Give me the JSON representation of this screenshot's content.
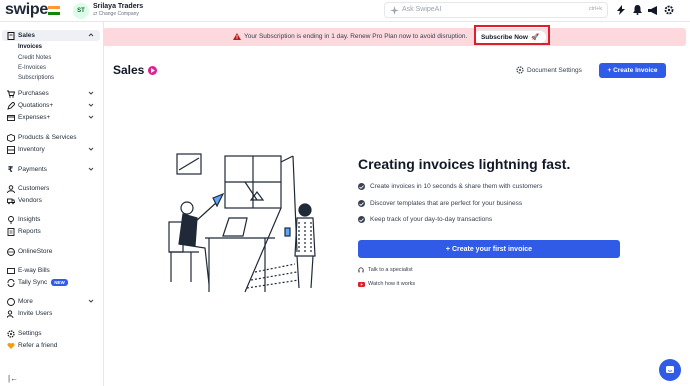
{
  "brand": {
    "logo": "swipe",
    "accent": "#2f5be7"
  },
  "company": {
    "initials": "ST",
    "name": "Srilaya Traders",
    "change_label": "Change Company"
  },
  "search": {
    "placeholder": "Ask SwipeAI",
    "shortcut": "ctrl+k"
  },
  "top_icons": [
    "bolt-icon",
    "bell-icon",
    "megaphone-icon",
    "settings-icon"
  ],
  "sidebar": {
    "sales": {
      "label": "Sales",
      "icon": "sales-icon"
    },
    "sales_subitems": [
      "Invoices",
      "Credit Notes",
      "E-Invoices",
      "Subscriptions"
    ],
    "items": [
      {
        "label": "Purchases",
        "icon": "cart-icon"
      },
      {
        "label": "Quotations+",
        "icon": "quote-icon"
      },
      {
        "label": "Expenses+",
        "icon": "expense-icon"
      },
      {
        "label": "Products & Services",
        "icon": "box-icon"
      },
      {
        "label": "Inventory",
        "icon": "inventory-icon"
      },
      {
        "label": "Payments",
        "icon": "rupee-icon"
      },
      {
        "label": "Customers",
        "icon": "user-icon"
      },
      {
        "label": "Vendors",
        "icon": "truck-icon"
      },
      {
        "label": "Insights",
        "icon": "bulb-icon"
      },
      {
        "label": "Reports",
        "icon": "report-icon"
      },
      {
        "label": "OnlineStore",
        "icon": "globe-icon"
      },
      {
        "label": "E-way Bills",
        "icon": "bill-icon"
      },
      {
        "label": "Tally Sync",
        "icon": "sync-icon",
        "badge": "NEW"
      },
      {
        "label": "More",
        "icon": "more-icon"
      },
      {
        "label": "Invite Users",
        "icon": "invite-icon"
      },
      {
        "label": "Settings",
        "icon": "settings-icon"
      },
      {
        "label": "Refer a friend",
        "icon": "heart-icon"
      }
    ]
  },
  "banner": {
    "message": "Your Subscription is ending in 1 day. Renew Pro Plan now to avoid disruption.",
    "button": "Subscribe Now"
  },
  "main": {
    "title": "Sales",
    "document_settings": "Document Settings",
    "create_button": "+ Create Invoice"
  },
  "hero": {
    "title": "Creating invoices lightning fast.",
    "features": [
      "Create invoices in 10 seconds & share them with customers",
      "Discover templates that are perfect for your business",
      "Keep track of your day-to-day transactions"
    ],
    "cta": "+ Create your first invoice",
    "talk_link": "Talk to a specialist",
    "video_link": "Watch how it works"
  }
}
